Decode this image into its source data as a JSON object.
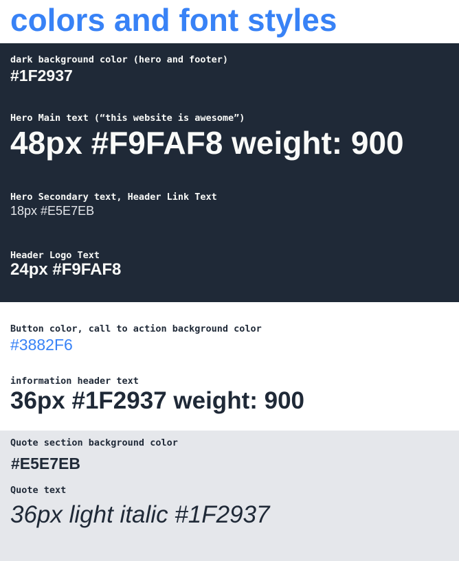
{
  "page": {
    "title": "colors and font styles"
  },
  "colors": {
    "blue": "#3882F6",
    "dark": "#1F2937",
    "offwhite": "#F9FAF8",
    "lightgray": "#E5E7EB"
  },
  "dark_section": {
    "bg_label": "dark background color (hero and footer)",
    "bg_value": "#1F2937",
    "hero_main_label": "Hero Main text (“this website is awesome”)",
    "hero_main_value": "48px #F9FAF8 weight: 900",
    "hero_secondary_label": "Hero Secondary text, Header Link Text",
    "hero_secondary_value": "18px #E5E7EB",
    "logo_label": "Header Logo Text",
    "logo_value": "24px #F9FAF8"
  },
  "light_section": {
    "button_label": "Button color, call to action background color",
    "button_value": "#3882F6",
    "info_label": "information header text",
    "info_value": "36px #1F2937 weight: 900"
  },
  "quote_section": {
    "bg_label": "Quote section background color",
    "bg_value": "#E5E7EB",
    "quote_label": "Quote text",
    "quote_value": "36px light italic #1F2937"
  }
}
